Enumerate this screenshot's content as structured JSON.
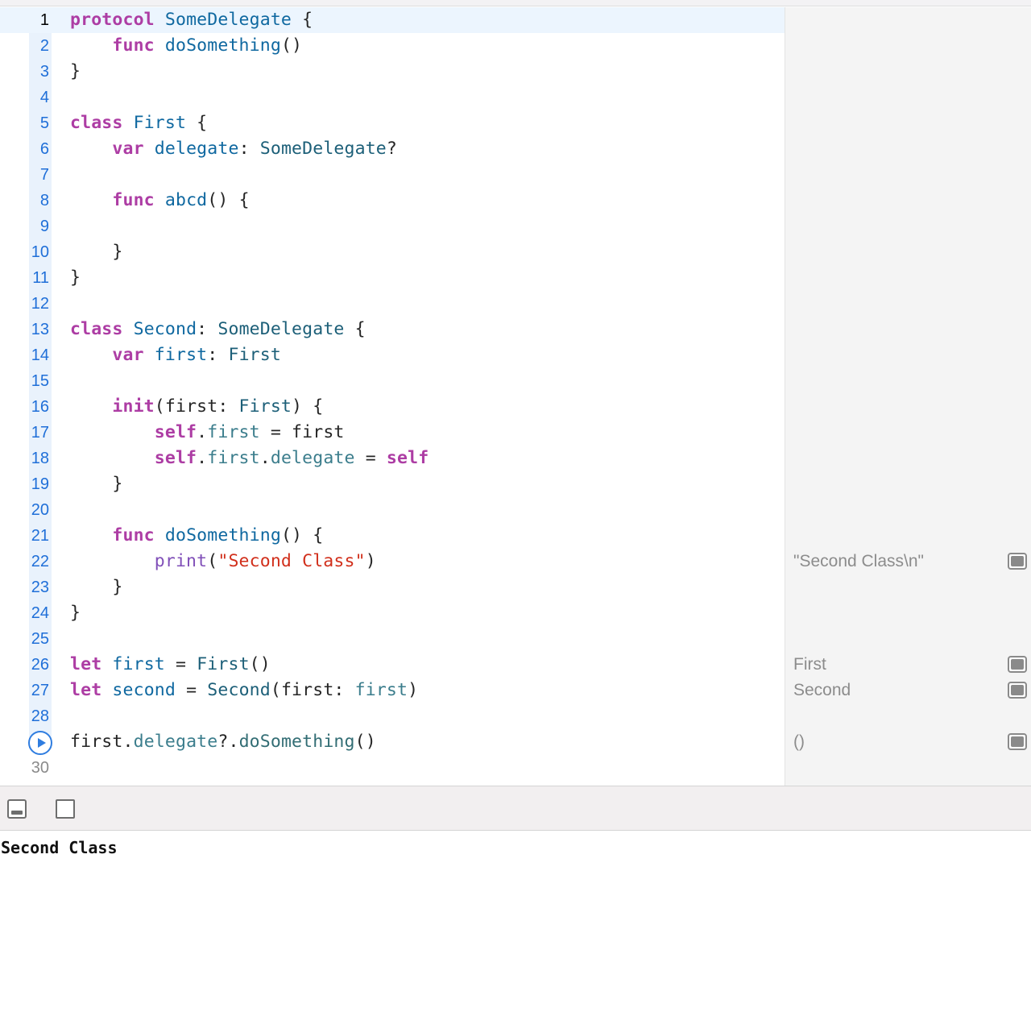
{
  "editor": {
    "lines": [
      {
        "n": "1",
        "tokens": [
          {
            "t": "protocol",
            "k": "kw"
          },
          {
            "t": " "
          },
          {
            "t": "SomeDelegate",
            "k": "decl"
          },
          {
            "t": " {"
          }
        ]
      },
      {
        "n": "2",
        "tokens": [
          {
            "t": "    "
          },
          {
            "t": "func",
            "k": "kw"
          },
          {
            "t": " "
          },
          {
            "t": "doSomething",
            "k": "decl"
          },
          {
            "t": "()"
          }
        ]
      },
      {
        "n": "3",
        "tokens": [
          {
            "t": "}"
          }
        ]
      },
      {
        "n": "4",
        "tokens": []
      },
      {
        "n": "5",
        "tokens": [
          {
            "t": "class",
            "k": "kw"
          },
          {
            "t": " "
          },
          {
            "t": "First",
            "k": "decl"
          },
          {
            "t": " {"
          }
        ]
      },
      {
        "n": "6",
        "tokens": [
          {
            "t": "    "
          },
          {
            "t": "var",
            "k": "kw"
          },
          {
            "t": " "
          },
          {
            "t": "delegate",
            "k": "decl"
          },
          {
            "t": ": "
          },
          {
            "t": "SomeDelegate",
            "k": "type"
          },
          {
            "t": "?"
          }
        ]
      },
      {
        "n": "7",
        "tokens": []
      },
      {
        "n": "8",
        "tokens": [
          {
            "t": "    "
          },
          {
            "t": "func",
            "k": "kw"
          },
          {
            "t": " "
          },
          {
            "t": "abcd",
            "k": "decl"
          },
          {
            "t": "() {"
          }
        ]
      },
      {
        "n": "9",
        "tokens": []
      },
      {
        "n": "10",
        "tokens": [
          {
            "t": "    }"
          }
        ]
      },
      {
        "n": "11",
        "tokens": [
          {
            "t": "}"
          }
        ]
      },
      {
        "n": "12",
        "tokens": []
      },
      {
        "n": "13",
        "tokens": [
          {
            "t": "class",
            "k": "kw"
          },
          {
            "t": " "
          },
          {
            "t": "Second",
            "k": "decl"
          },
          {
            "t": ": "
          },
          {
            "t": "SomeDelegate",
            "k": "type"
          },
          {
            "t": " {"
          }
        ]
      },
      {
        "n": "14",
        "tokens": [
          {
            "t": "    "
          },
          {
            "t": "var",
            "k": "kw"
          },
          {
            "t": " "
          },
          {
            "t": "first",
            "k": "decl"
          },
          {
            "t": ": "
          },
          {
            "t": "First",
            "k": "type"
          }
        ]
      },
      {
        "n": "15",
        "tokens": []
      },
      {
        "n": "16",
        "tokens": [
          {
            "t": "    "
          },
          {
            "t": "init",
            "k": "kw"
          },
          {
            "t": "(first: "
          },
          {
            "t": "First",
            "k": "type"
          },
          {
            "t": ") {"
          }
        ]
      },
      {
        "n": "17",
        "tokens": [
          {
            "t": "        "
          },
          {
            "t": "self",
            "k": "kw"
          },
          {
            "t": "."
          },
          {
            "t": "first",
            "k": "member"
          },
          {
            "t": " = first"
          }
        ]
      },
      {
        "n": "18",
        "tokens": [
          {
            "t": "        "
          },
          {
            "t": "self",
            "k": "kw"
          },
          {
            "t": "."
          },
          {
            "t": "first",
            "k": "member"
          },
          {
            "t": "."
          },
          {
            "t": "delegate",
            "k": "member"
          },
          {
            "t": " = "
          },
          {
            "t": "self",
            "k": "kw"
          }
        ]
      },
      {
        "n": "19",
        "tokens": [
          {
            "t": "    }"
          }
        ]
      },
      {
        "n": "20",
        "tokens": []
      },
      {
        "n": "21",
        "tokens": [
          {
            "t": "    "
          },
          {
            "t": "func",
            "k": "kw"
          },
          {
            "t": " "
          },
          {
            "t": "doSomething",
            "k": "decl"
          },
          {
            "t": "() {"
          }
        ]
      },
      {
        "n": "22",
        "tokens": [
          {
            "t": "        "
          },
          {
            "t": "print",
            "k": "builtin"
          },
          {
            "t": "("
          },
          {
            "t": "\"Second Class\"",
            "k": "str"
          },
          {
            "t": ")"
          }
        ]
      },
      {
        "n": "23",
        "tokens": [
          {
            "t": "    }"
          }
        ]
      },
      {
        "n": "24",
        "tokens": [
          {
            "t": "}"
          }
        ]
      },
      {
        "n": "25",
        "tokens": []
      },
      {
        "n": "26",
        "tokens": [
          {
            "t": "let",
            "k": "kw"
          },
          {
            "t": " "
          },
          {
            "t": "first",
            "k": "decl"
          },
          {
            "t": " = "
          },
          {
            "t": "First",
            "k": "type"
          },
          {
            "t": "()"
          }
        ]
      },
      {
        "n": "27",
        "tokens": [
          {
            "t": "let",
            "k": "kw"
          },
          {
            "t": " "
          },
          {
            "t": "second",
            "k": "decl"
          },
          {
            "t": " = "
          },
          {
            "t": "Second",
            "k": "type"
          },
          {
            "t": "(first: "
          },
          {
            "t": "first",
            "k": "member"
          },
          {
            "t": ")"
          }
        ]
      },
      {
        "n": "28",
        "tokens": []
      },
      {
        "n": "",
        "run": true,
        "tokens": [
          {
            "t": "first",
            "k": "plain"
          },
          {
            "t": "."
          },
          {
            "t": "delegate",
            "k": "member"
          },
          {
            "t": "?."
          },
          {
            "t": "doSomething",
            "k": "func"
          },
          {
            "t": "()"
          }
        ]
      },
      {
        "n": "30",
        "tokens": []
      }
    ]
  },
  "results": [
    {
      "line": 22,
      "text": "\"Second Class\\n\""
    },
    {
      "line": 26,
      "text": "First"
    },
    {
      "line": 27,
      "text": "Second"
    },
    {
      "line": 29,
      "text": "()"
    }
  ],
  "console": {
    "output": "Second Class"
  },
  "icons": {
    "run": "play-circle-icon",
    "quick_look": "quick-look-icon",
    "hide_debug": "hide-debug-area-icon",
    "toggle_panel": "panel-toggle-icon"
  },
  "colors": {
    "keyword": "#ad3da4",
    "string": "#d12f1b",
    "line_number": "#1f6fd8",
    "run_accent": "#2f7de0"
  }
}
